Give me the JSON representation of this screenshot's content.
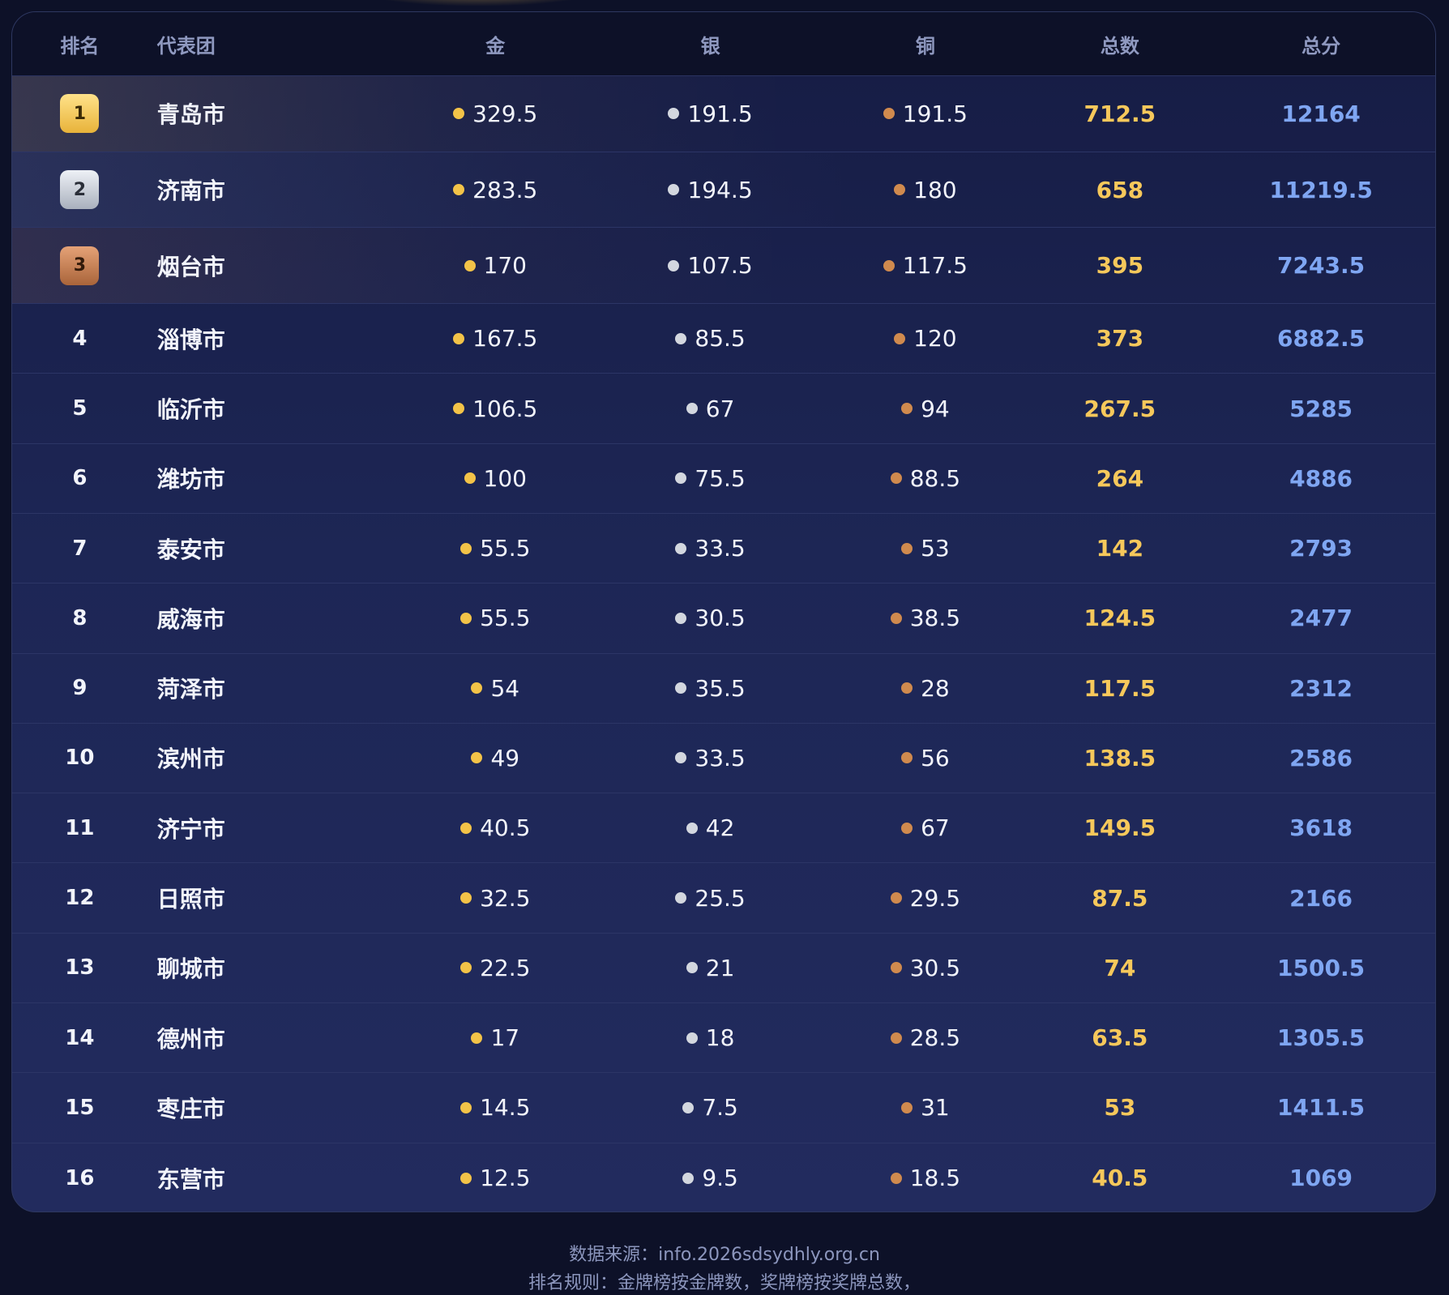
{
  "header": {
    "rank": "排名",
    "team": "代表团",
    "gold": "金",
    "silver": "银",
    "bronze": "铜",
    "total": "总数",
    "score": "总分"
  },
  "rows": [
    {
      "rank": "1",
      "team": "青岛市",
      "gold": "329.5",
      "silver": "191.5",
      "bronze": "191.5",
      "total": "712.5",
      "score": "12164"
    },
    {
      "rank": "2",
      "team": "济南市",
      "gold": "283.5",
      "silver": "194.5",
      "bronze": "180",
      "total": "658",
      "score": "11219.5"
    },
    {
      "rank": "3",
      "team": "烟台市",
      "gold": "170",
      "silver": "107.5",
      "bronze": "117.5",
      "total": "395",
      "score": "7243.5"
    },
    {
      "rank": "4",
      "team": "淄博市",
      "gold": "167.5",
      "silver": "85.5",
      "bronze": "120",
      "total": "373",
      "score": "6882.5"
    },
    {
      "rank": "5",
      "team": "临沂市",
      "gold": "106.5",
      "silver": "67",
      "bronze": "94",
      "total": "267.5",
      "score": "5285"
    },
    {
      "rank": "6",
      "team": "潍坊市",
      "gold": "100",
      "silver": "75.5",
      "bronze": "88.5",
      "total": "264",
      "score": "4886"
    },
    {
      "rank": "7",
      "team": "泰安市",
      "gold": "55.5",
      "silver": "33.5",
      "bronze": "53",
      "total": "142",
      "score": "2793"
    },
    {
      "rank": "8",
      "team": "威海市",
      "gold": "55.5",
      "silver": "30.5",
      "bronze": "38.5",
      "total": "124.5",
      "score": "2477"
    },
    {
      "rank": "9",
      "team": "菏泽市",
      "gold": "54",
      "silver": "35.5",
      "bronze": "28",
      "total": "117.5",
      "score": "2312"
    },
    {
      "rank": "10",
      "team": "滨州市",
      "gold": "49",
      "silver": "33.5",
      "bronze": "56",
      "total": "138.5",
      "score": "2586"
    },
    {
      "rank": "11",
      "team": "济宁市",
      "gold": "40.5",
      "silver": "42",
      "bronze": "67",
      "total": "149.5",
      "score": "3618"
    },
    {
      "rank": "12",
      "team": "日照市",
      "gold": "32.5",
      "silver": "25.5",
      "bronze": "29.5",
      "total": "87.5",
      "score": "2166"
    },
    {
      "rank": "13",
      "team": "聊城市",
      "gold": "22.5",
      "silver": "21",
      "bronze": "30.5",
      "total": "74",
      "score": "1500.5"
    },
    {
      "rank": "14",
      "team": "德州市",
      "gold": "17",
      "silver": "18",
      "bronze": "28.5",
      "total": "63.5",
      "score": "1305.5"
    },
    {
      "rank": "15",
      "team": "枣庄市",
      "gold": "14.5",
      "silver": "7.5",
      "bronze": "31",
      "total": "53",
      "score": "1411.5"
    },
    {
      "rank": "16",
      "team": "东营市",
      "gold": "12.5",
      "silver": "9.5",
      "bronze": "18.5",
      "total": "40.5",
      "score": "1069"
    }
  ],
  "footer": {
    "source": "数据来源：info.2026sdsydhly.org.cn",
    "rule": "排名规则：金牌榜按金牌数，奖牌榜按奖牌总数，"
  },
  "colors": {
    "gold": "#f3c348",
    "silver": "#d3d7df",
    "bronze": "#d08a4e",
    "total": "#f6c85b",
    "score": "#7fa6f2"
  }
}
